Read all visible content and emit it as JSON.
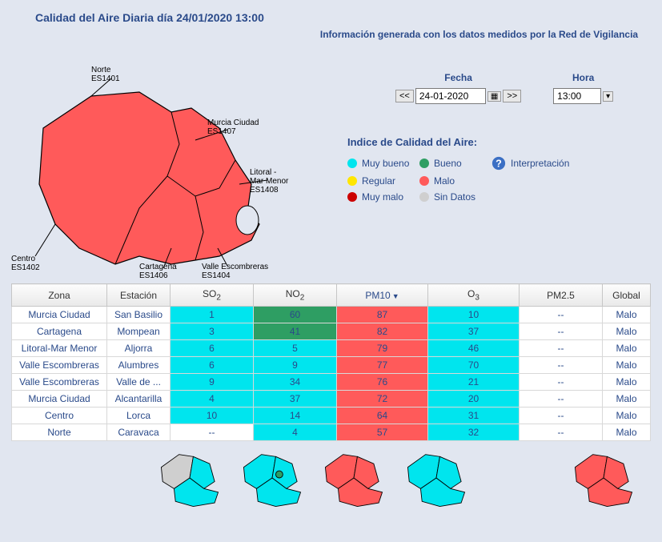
{
  "title": "Calidad del Aire Diaria día 24/01/2020 13:00",
  "subtitle": "Información generada con los datos medidos por la Red de Vigilancia",
  "controls": {
    "fecha_label": "Fecha",
    "hora_label": "Hora",
    "prev": "<<",
    "next": ">>",
    "date_value": "24-01-2020",
    "time_value": "13:00"
  },
  "map_zones": {
    "norte": "Norte\nES1401",
    "murcia": "Murcia Ciudad\nES1407",
    "litoral": "Litoral -\nMar Menor\nES1408",
    "cartagena": "Cartagena\nES1406",
    "valle": "Valle Escombreras\nES1404",
    "centro": "Centro\nES1402"
  },
  "legend": {
    "title": "Indice de Calidad del Aire:",
    "muy_bueno": "Muy bueno",
    "bueno": "Bueno",
    "regular": "Regular",
    "malo": "Malo",
    "muy_malo": "Muy malo",
    "sin_datos": "Sin Datos",
    "interpretacion": "Interpretación"
  },
  "colors": {
    "muy_bueno": "#00e5ee",
    "bueno": "#2e9e63",
    "regular": "#ffe600",
    "malo": "#ff5a5a",
    "muy_malo": "#cc0000",
    "sin_datos": "#cfcfcf",
    "none": "#ffffff"
  },
  "table": {
    "headers": {
      "zona": "Zona",
      "estacion": "Estación",
      "so2": "SO",
      "so2_sub": "2",
      "no2": "NO",
      "no2_sub": "2",
      "pm10": "PM10",
      "o3": "O",
      "o3_sub": "3",
      "pm25": "PM2.5",
      "global": "Global"
    },
    "sorted_col": "pm10",
    "rows": [
      {
        "zona": "Murcia Ciudad",
        "estacion": "San Basilio",
        "so2": {
          "v": "1",
          "q": "muy_bueno"
        },
        "no2": {
          "v": "60",
          "q": "bueno"
        },
        "pm10": {
          "v": "87",
          "q": "malo"
        },
        "o3": {
          "v": "10",
          "q": "muy_bueno"
        },
        "pm25": {
          "v": "--",
          "q": "none"
        },
        "global": {
          "v": "Malo",
          "q": "none"
        }
      },
      {
        "zona": "Cartagena",
        "estacion": "Mompean",
        "so2": {
          "v": "3",
          "q": "muy_bueno"
        },
        "no2": {
          "v": "41",
          "q": "bueno"
        },
        "pm10": {
          "v": "82",
          "q": "malo"
        },
        "o3": {
          "v": "37",
          "q": "muy_bueno"
        },
        "pm25": {
          "v": "--",
          "q": "none"
        },
        "global": {
          "v": "Malo",
          "q": "none"
        }
      },
      {
        "zona": "Litoral-Mar Menor",
        "estacion": "Aljorra",
        "so2": {
          "v": "6",
          "q": "muy_bueno"
        },
        "no2": {
          "v": "5",
          "q": "muy_bueno"
        },
        "pm10": {
          "v": "79",
          "q": "malo"
        },
        "o3": {
          "v": "46",
          "q": "muy_bueno"
        },
        "pm25": {
          "v": "--",
          "q": "none"
        },
        "global": {
          "v": "Malo",
          "q": "none"
        }
      },
      {
        "zona": "Valle Escombreras",
        "estacion": "Alumbres",
        "so2": {
          "v": "6",
          "q": "muy_bueno"
        },
        "no2": {
          "v": "9",
          "q": "muy_bueno"
        },
        "pm10": {
          "v": "77",
          "q": "malo"
        },
        "o3": {
          "v": "70",
          "q": "muy_bueno"
        },
        "pm25": {
          "v": "--",
          "q": "none"
        },
        "global": {
          "v": "Malo",
          "q": "none"
        }
      },
      {
        "zona": "Valle Escombreras",
        "estacion": "Valle de ...",
        "so2": {
          "v": "9",
          "q": "muy_bueno"
        },
        "no2": {
          "v": "34",
          "q": "muy_bueno"
        },
        "pm10": {
          "v": "76",
          "q": "malo"
        },
        "o3": {
          "v": "21",
          "q": "muy_bueno"
        },
        "pm25": {
          "v": "--",
          "q": "none"
        },
        "global": {
          "v": "Malo",
          "q": "none"
        }
      },
      {
        "zona": "Murcia Ciudad",
        "estacion": "Alcantarilla",
        "so2": {
          "v": "4",
          "q": "muy_bueno"
        },
        "no2": {
          "v": "37",
          "q": "muy_bueno"
        },
        "pm10": {
          "v": "72",
          "q": "malo"
        },
        "o3": {
          "v": "20",
          "q": "muy_bueno"
        },
        "pm25": {
          "v": "--",
          "q": "none"
        },
        "global": {
          "v": "Malo",
          "q": "none"
        }
      },
      {
        "zona": "Centro",
        "estacion": "Lorca",
        "so2": {
          "v": "10",
          "q": "muy_bueno"
        },
        "no2": {
          "v": "14",
          "q": "muy_bueno"
        },
        "pm10": {
          "v": "64",
          "q": "malo"
        },
        "o3": {
          "v": "31",
          "q": "muy_bueno"
        },
        "pm25": {
          "v": "--",
          "q": "none"
        },
        "global": {
          "v": "Malo",
          "q": "none"
        }
      },
      {
        "zona": "Norte",
        "estacion": "Caravaca",
        "so2": {
          "v": "--",
          "q": "none"
        },
        "no2": {
          "v": "4",
          "q": "muy_bueno"
        },
        "pm10": {
          "v": "57",
          "q": "malo"
        },
        "o3": {
          "v": "32",
          "q": "muy_bueno"
        },
        "pm25": {
          "v": "--",
          "q": "none"
        },
        "global": {
          "v": "Malo",
          "q": "none"
        }
      }
    ]
  },
  "mini_maps": [
    {
      "id": "so2",
      "colors": {
        "nw": "sin_datos",
        "center": "muy_bueno",
        "se": "muy_bueno"
      }
    },
    {
      "id": "no2",
      "colors": {
        "nw": "muy_bueno",
        "center": "muy_bueno",
        "se": "muy_bueno",
        "spot": "bueno"
      }
    },
    {
      "id": "pm10",
      "colors": {
        "nw": "malo",
        "center": "malo",
        "se": "malo"
      }
    },
    {
      "id": "o3",
      "colors": {
        "nw": "muy_bueno",
        "center": "muy_bueno",
        "se": "muy_bueno"
      }
    },
    {
      "id": "global",
      "colors": {
        "nw": "malo",
        "center": "malo",
        "se": "malo"
      }
    }
  ]
}
